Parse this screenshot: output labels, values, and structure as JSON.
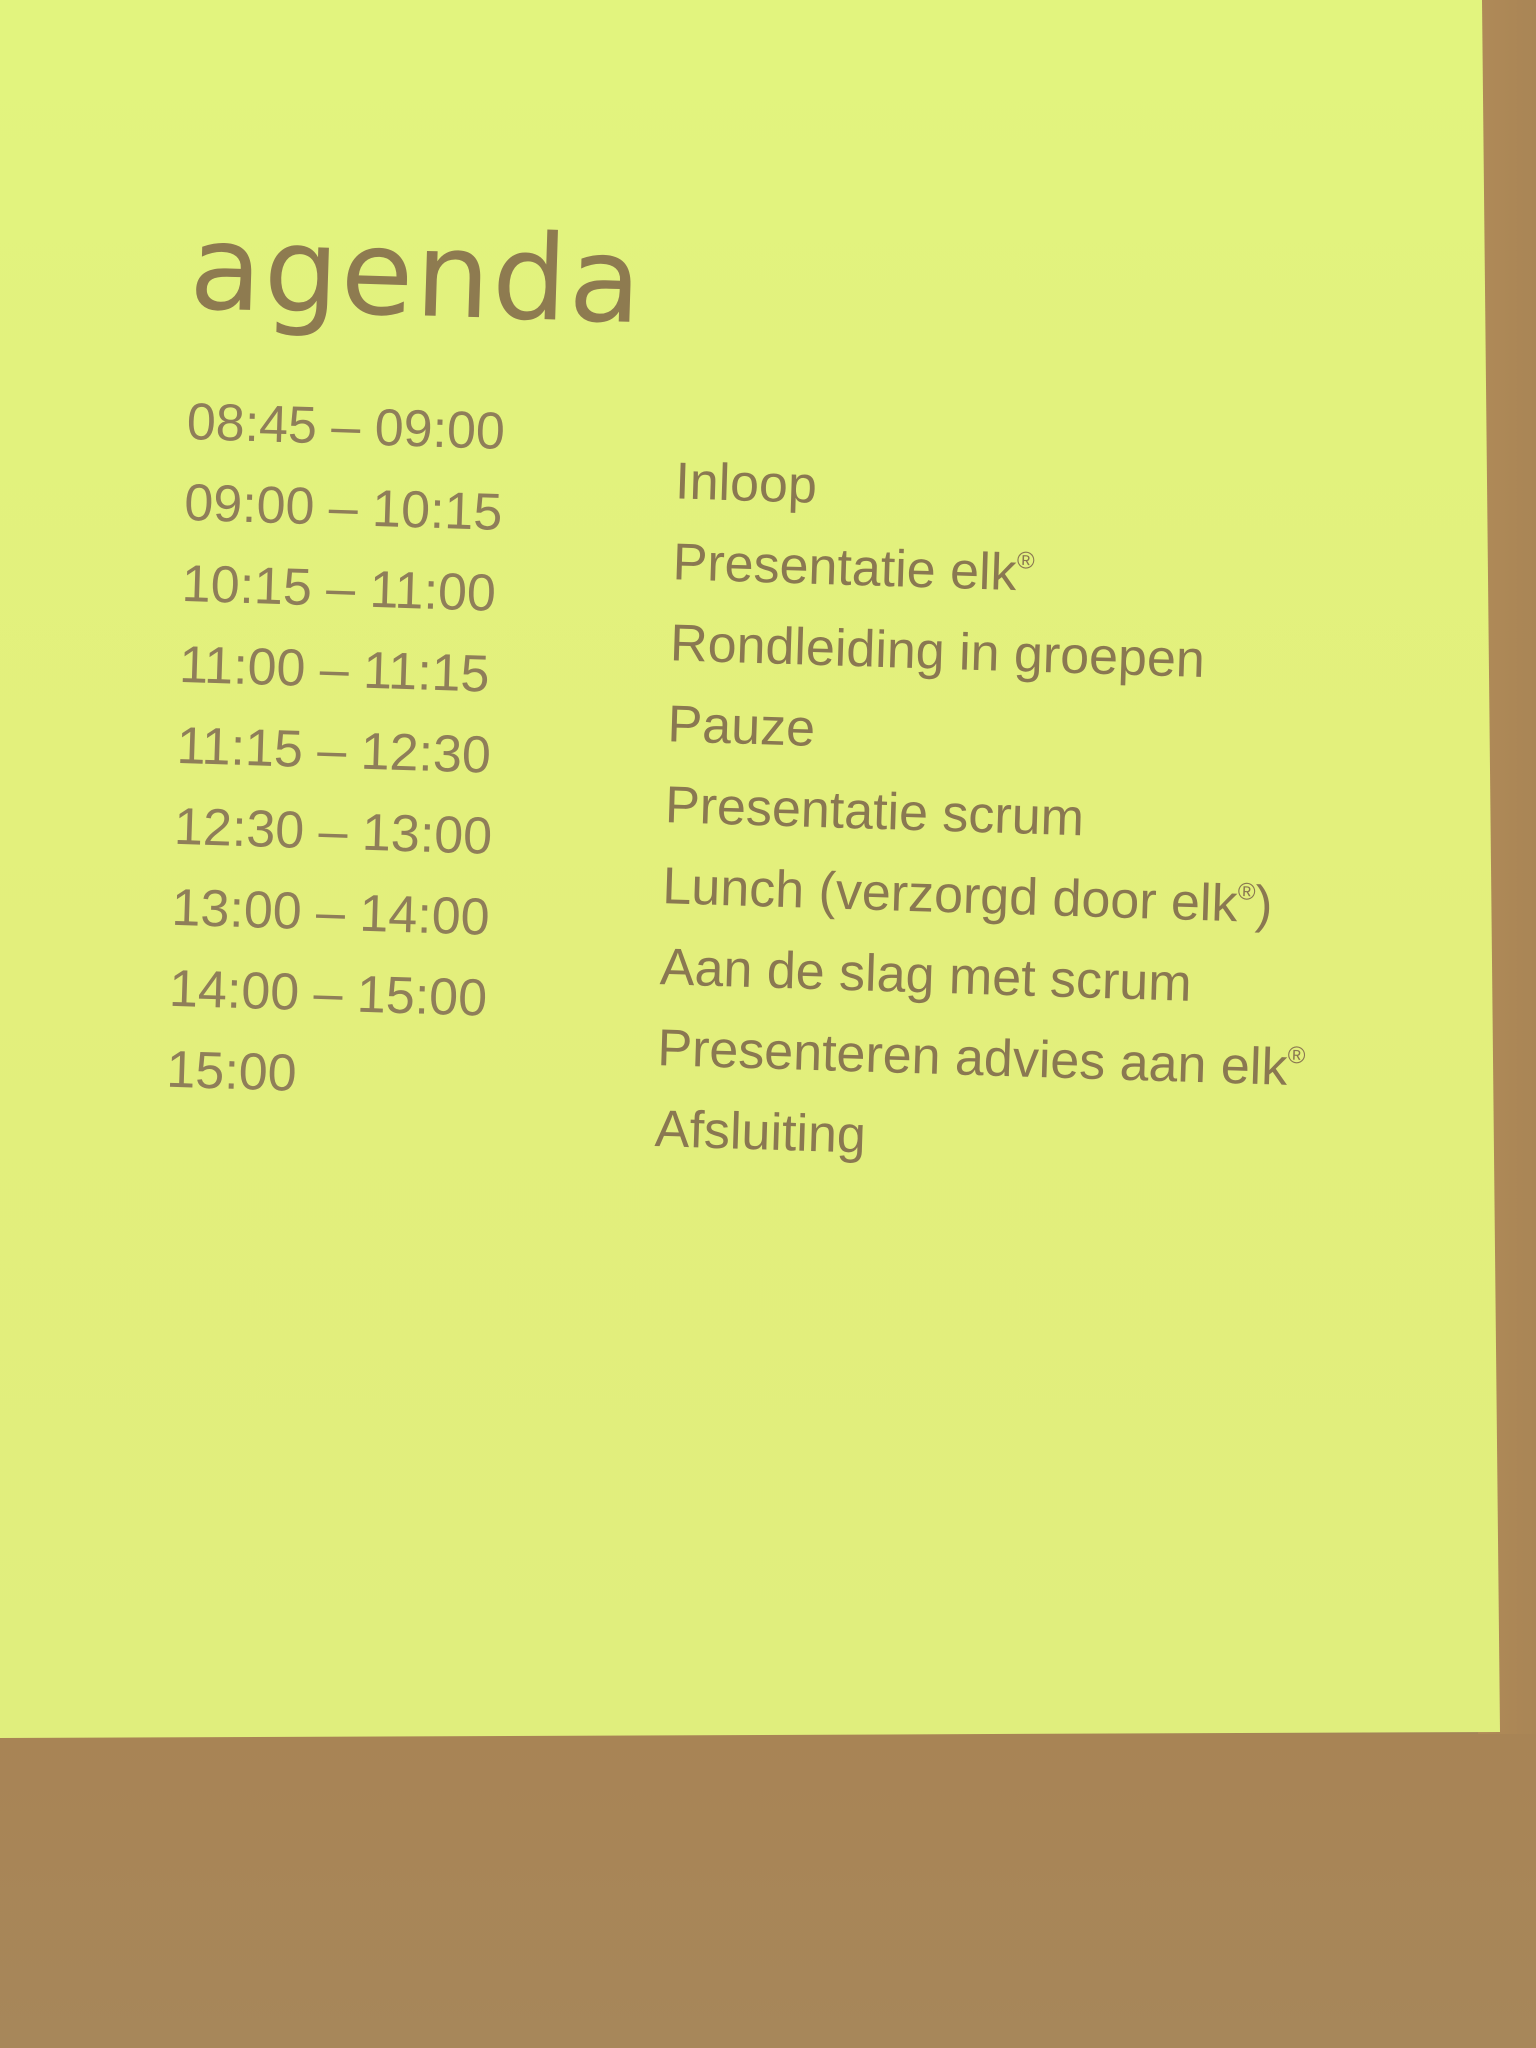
{
  "slide": {
    "title": "agenda",
    "rows": [
      {
        "time": "08:45 – 09:00",
        "activity": "Inloop",
        "activity_after": ""
      },
      {
        "time": "09:00 – 10:15",
        "activity": "Presentatie elk",
        "activity_after": ""
      },
      {
        "time": "10:15 – 11:00",
        "activity": "Rondleiding in groepen",
        "activity_after": ""
      },
      {
        "time": "11:00 – 11:15",
        "activity": "Pauze",
        "activity_after": ""
      },
      {
        "time": "11:15 – 12:30",
        "activity": "Presentatie scrum",
        "activity_after": ""
      },
      {
        "time": "12:30 – 13:00",
        "activity": "Lunch (verzorgd door elk",
        "activity_after": ")"
      },
      {
        "time": "13:00 – 14:00",
        "activity": "Aan de slag met scrum",
        "activity_after": ""
      },
      {
        "time": "14:00 – 15:00",
        "activity": "Presenteren advies aan elk",
        "activity_after": ""
      },
      {
        "time": "15:00",
        "activity": "Afsluiting",
        "activity_after": ""
      }
    ],
    "registered_mark": "®"
  }
}
